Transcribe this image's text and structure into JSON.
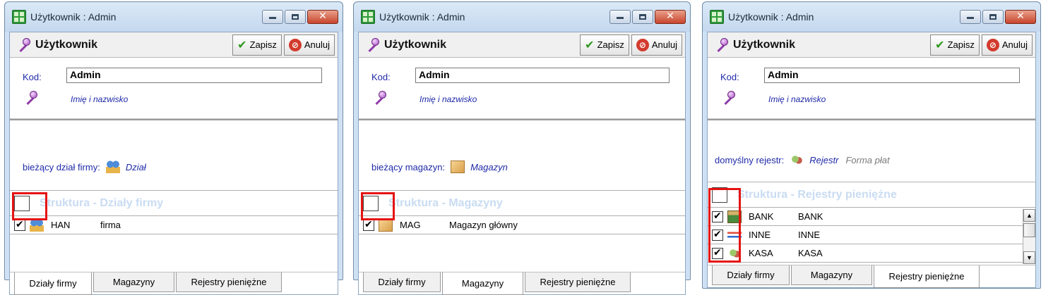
{
  "windows": [
    {
      "title": "Użytkownik : Admin",
      "header_title": "Użytkownik",
      "save_label": "Zapisz",
      "cancel_label": "Anuluj",
      "kod_label": "Kod:",
      "kod_value": "Admin",
      "name_link": "Imię i nazwisko",
      "ref_label": "bieżący dział firmy:",
      "ref_link": "Dział",
      "ref_extra": "",
      "ref_icon": "people-icon",
      "grid_title": "Struktura - Działy firmy",
      "rows": [
        {
          "code": "HAN",
          "name": "firma",
          "checked": true,
          "icon": "people-icon"
        }
      ],
      "tabs": [
        "Działy firmy",
        "Magazyny",
        "Rejestry pieniężne"
      ],
      "active_tab": 0
    },
    {
      "title": "Użytkownik : Admin",
      "header_title": "Użytkownik",
      "save_label": "Zapisz",
      "cancel_label": "Anuluj",
      "kod_label": "Kod:",
      "kod_value": "Admin",
      "name_link": "Imię i nazwisko",
      "ref_label": "bieżący magazyn:",
      "ref_link": "Magazyn",
      "ref_extra": "",
      "ref_icon": "box-icon",
      "grid_title": "Struktura - Magazyny",
      "rows": [
        {
          "code": "MAG",
          "name": "Magazyn główny",
          "checked": true,
          "icon": "box-icon"
        }
      ],
      "tabs": [
        "Działy firmy",
        "Magazyny",
        "Rejestry pieniężne"
      ],
      "active_tab": 1
    },
    {
      "title": "Użytkownik : Admin",
      "header_title": "Użytkownik",
      "save_label": "Zapisz",
      "cancel_label": "Anuluj",
      "kod_label": "Kod:",
      "kod_value": "Admin",
      "name_link": "Imię i nazwisko",
      "ref_label": "domyślny rejestr:",
      "ref_link": "Rejestr",
      "ref_extra": "Forma płat",
      "ref_icon": "coins-icon",
      "grid_title": "Struktura - Rejestry pieniężne",
      "rows": [
        {
          "code": "BANK",
          "name": "BANK",
          "checked": true,
          "icon": "bank-icon"
        },
        {
          "code": "INNE",
          "name": "INNE",
          "checked": true,
          "icon": "inne-icon"
        },
        {
          "code": "KASA",
          "name": "KASA",
          "checked": true,
          "icon": "coins-icon"
        }
      ],
      "tabs": [
        "Działy firmy",
        "Magazyny",
        "Rejestry pieniężne"
      ],
      "active_tab": 2
    }
  ]
}
